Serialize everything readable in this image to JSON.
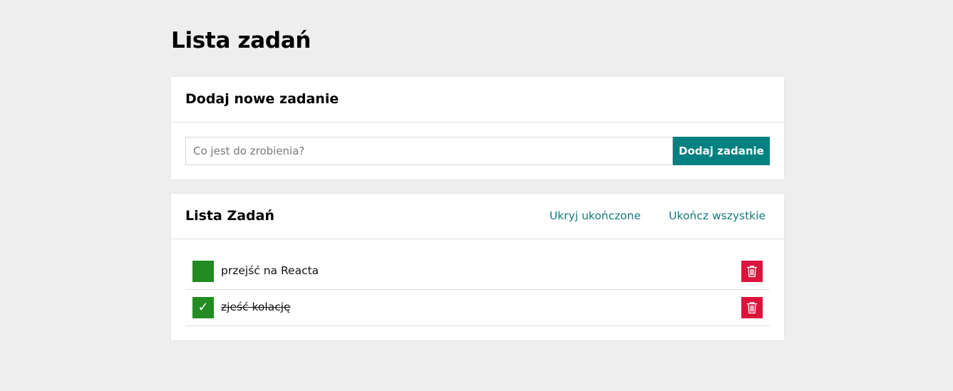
{
  "page": {
    "title": "Lista zadań"
  },
  "add_form": {
    "title": "Dodaj nowe zadanie",
    "input_value": "",
    "input_placeholder": "Co jest do zrobienia?",
    "button_label": "Dodaj zadanie"
  },
  "list": {
    "title": "Lista Zadań",
    "hide_done_label": "Ukryj ukończone",
    "finish_all_label": "Ukończ wszystkie",
    "tasks": [
      {
        "content": "przejść na Reacta",
        "done": false,
        "check_mark": ""
      },
      {
        "content": "zjeść kolację",
        "done": true,
        "check_mark": "✓"
      }
    ]
  },
  "colors": {
    "background": "#eeeeee",
    "accent": "#008080",
    "link": "#137a7a",
    "checkbox": "#228b22",
    "delete": "#dc143c"
  },
  "icons": {
    "delete": "trash-icon",
    "done": "checkmark-icon"
  }
}
